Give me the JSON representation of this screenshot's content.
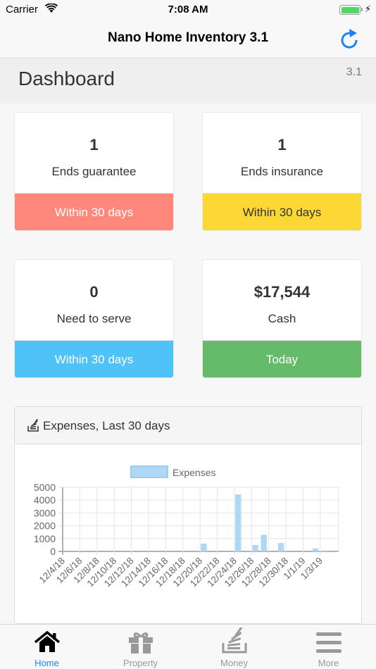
{
  "status_bar": {
    "carrier": "Carrier",
    "time": "7:08 AM"
  },
  "nav": {
    "title": "Nano Home Inventory 3.1",
    "refresh_icon": "refresh-icon"
  },
  "dashboard": {
    "title": "Dashboard",
    "version": "3.1"
  },
  "cards": [
    {
      "value": "1",
      "label": "Ends guarantee",
      "footer": "Within 30 days",
      "color": "#ff887c",
      "text_color": "#ffffff"
    },
    {
      "value": "1",
      "label": "Ends insurance",
      "footer": "Within 30 days",
      "color": "#fdd835",
      "text_color": "#333333"
    },
    {
      "value": "0",
      "label": "Need to serve",
      "footer": "Within 30 days",
      "color": "#4fc3f7",
      "text_color": "#ffffff"
    },
    {
      "value": "$17,544",
      "label": "Cash",
      "footer": "Today",
      "color": "#66bb6a",
      "text_color": "#ffffff"
    }
  ],
  "panel": {
    "title": "Expenses, Last 30 days",
    "icon": "stack-icon"
  },
  "chart_data": {
    "type": "bar",
    "title": "",
    "legend": [
      "Expenses"
    ],
    "legend_position": "top",
    "xlabel": "",
    "ylabel": "",
    "ylim": [
      0,
      5000
    ],
    "yticks": [
      "5000",
      "4000",
      "3000",
      "2000",
      "1000",
      "0"
    ],
    "xticks": [
      "12/4/18",
      "12/6/18",
      "12/8/18",
      "12/10/18",
      "12/12/18",
      "12/14/18",
      "12/16/18",
      "12/18/18",
      "12/20/18",
      "12/22/18",
      "12/24/18",
      "12/26/18",
      "12/28/18",
      "12/30/18",
      "1/1/19",
      "1/3/19"
    ],
    "grid": true,
    "series": [
      {
        "name": "Expenses",
        "color": "#aed8f6",
        "points": [
          {
            "date": "12/20/18",
            "value": 600
          },
          {
            "date": "12/24/18",
            "value": 4450
          },
          {
            "date": "12/26/18",
            "value": 500
          },
          {
            "date": "12/27/18",
            "value": 1300
          },
          {
            "date": "12/29/18",
            "value": 650
          },
          {
            "date": "1/2/19",
            "value": 230
          },
          {
            "date": "1/3/19",
            "value": 80
          }
        ]
      }
    ]
  },
  "tabs": [
    {
      "label": "Home",
      "icon": "home-icon",
      "active": true
    },
    {
      "label": "Property",
      "icon": "gift-icon",
      "active": false
    },
    {
      "label": "Money",
      "icon": "stack-icon",
      "active": false
    },
    {
      "label": "More",
      "icon": "menu-icon",
      "active": false
    }
  ]
}
